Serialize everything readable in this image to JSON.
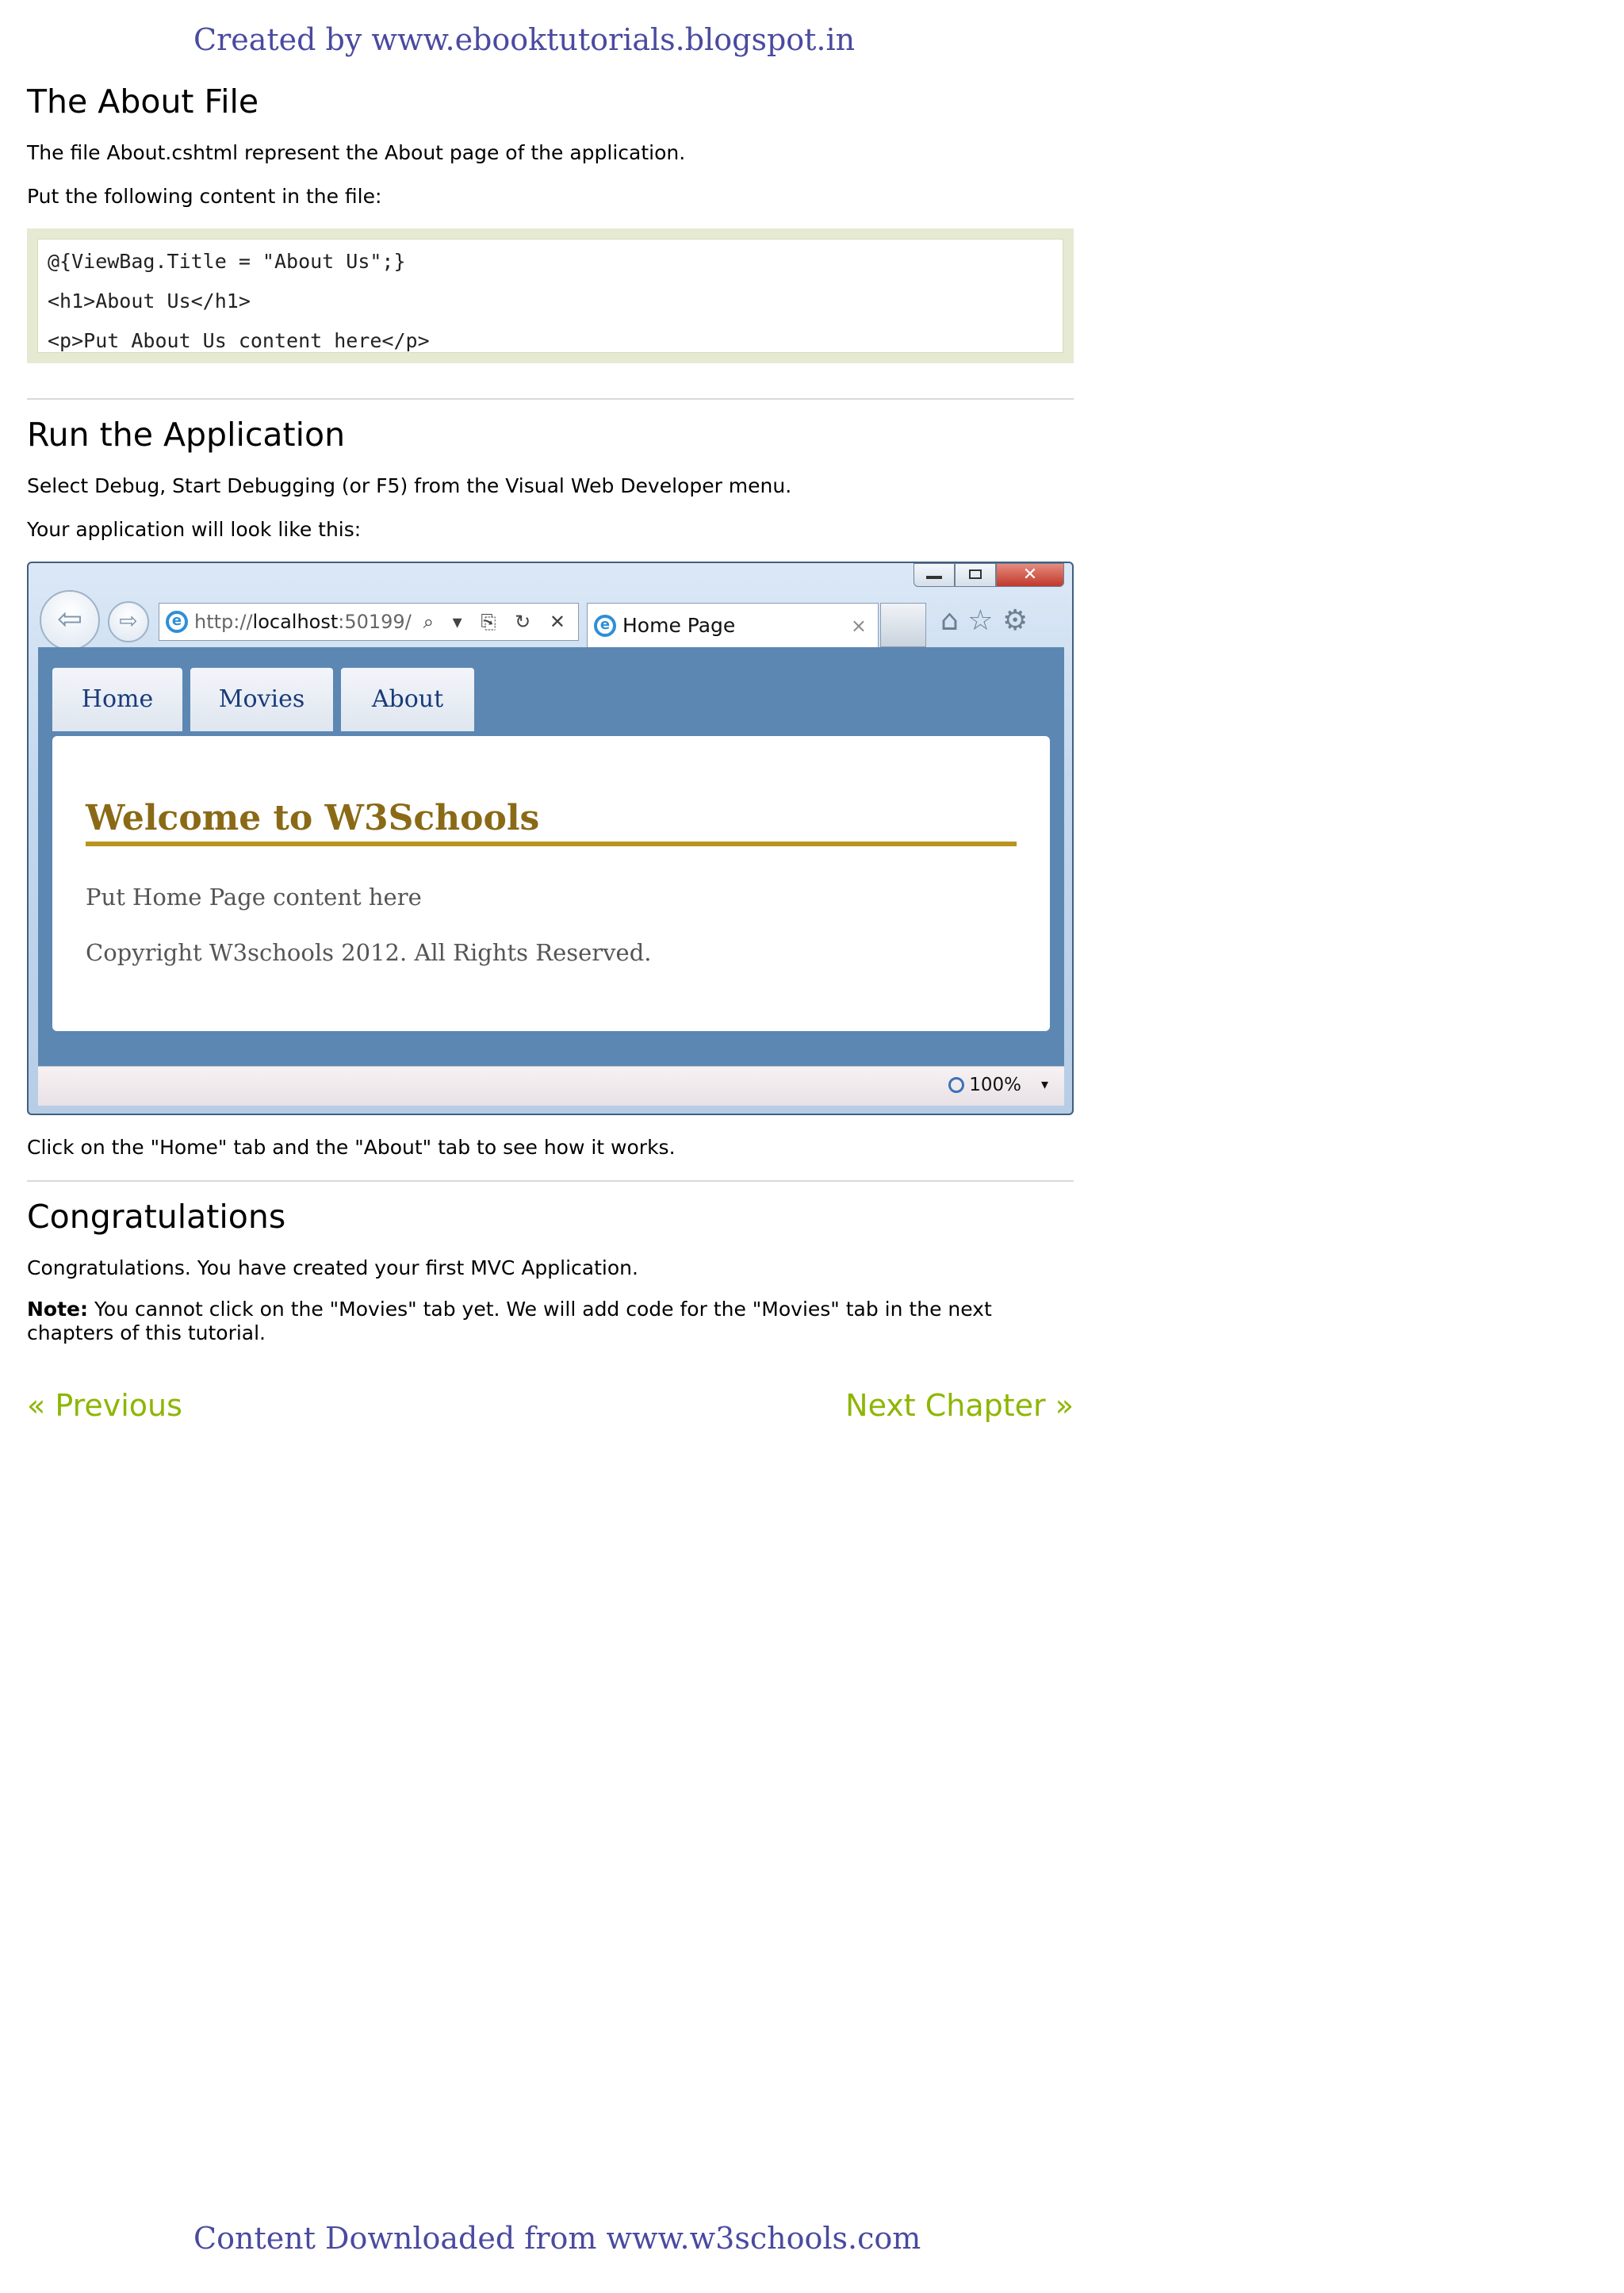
{
  "header_banner": "Created by www.ebooktutorials.blogspot.in",
  "footer_banner": "Content Downloaded from www.w3schools.com",
  "section_about": {
    "title": "The About File",
    "p1": "The file About.cshtml represent the About page of the application.",
    "p2": "Put the following content in the file:",
    "code": [
      "@{ViewBag.Title = \"About Us\";}",
      "<h1>About Us</h1>",
      "<p>Put About Us content here</p>"
    ]
  },
  "section_run": {
    "title": "Run the Application",
    "p1": "Select Debug, Start Debugging (or F5) from the Visual Web Developer menu.",
    "p2": "Your application will look like this:",
    "after": "Click on the \"Home\" tab and the \"About\" tab to see how it works."
  },
  "browser": {
    "url_prefix": "http://",
    "url_host": "localhost",
    "url_port": ":50199/",
    "addr_tools": "⌕ ▾ ⎘ ↻ ✕",
    "tab_title": "Home Page",
    "tab_close": "×",
    "toolbar_icons": "⌂ ☆ ⚙",
    "site_tabs": [
      "Home",
      "Movies",
      "About"
    ],
    "welcome": "Welcome to W3Schools",
    "body_text": "Put Home Page content here",
    "copyright": "Copyright W3schools 2012. All Rights Reserved.",
    "zoom": "100%",
    "close_glyph": "✕",
    "back_glyph": "⇦",
    "fwd_glyph": "⇨",
    "dropdown_glyph": "▾"
  },
  "section_congrats": {
    "title": "Congratulations",
    "p1": "Congratulations. You have created your first MVC Application.",
    "note_label": "Note:",
    "note_text": " You cannot click on the \"Movies\" tab yet. We will add code for the \"Movies\" tab in the next chapters of this tutorial."
  },
  "nav": {
    "previous": "« Previous",
    "next": "Next Chapter »"
  }
}
